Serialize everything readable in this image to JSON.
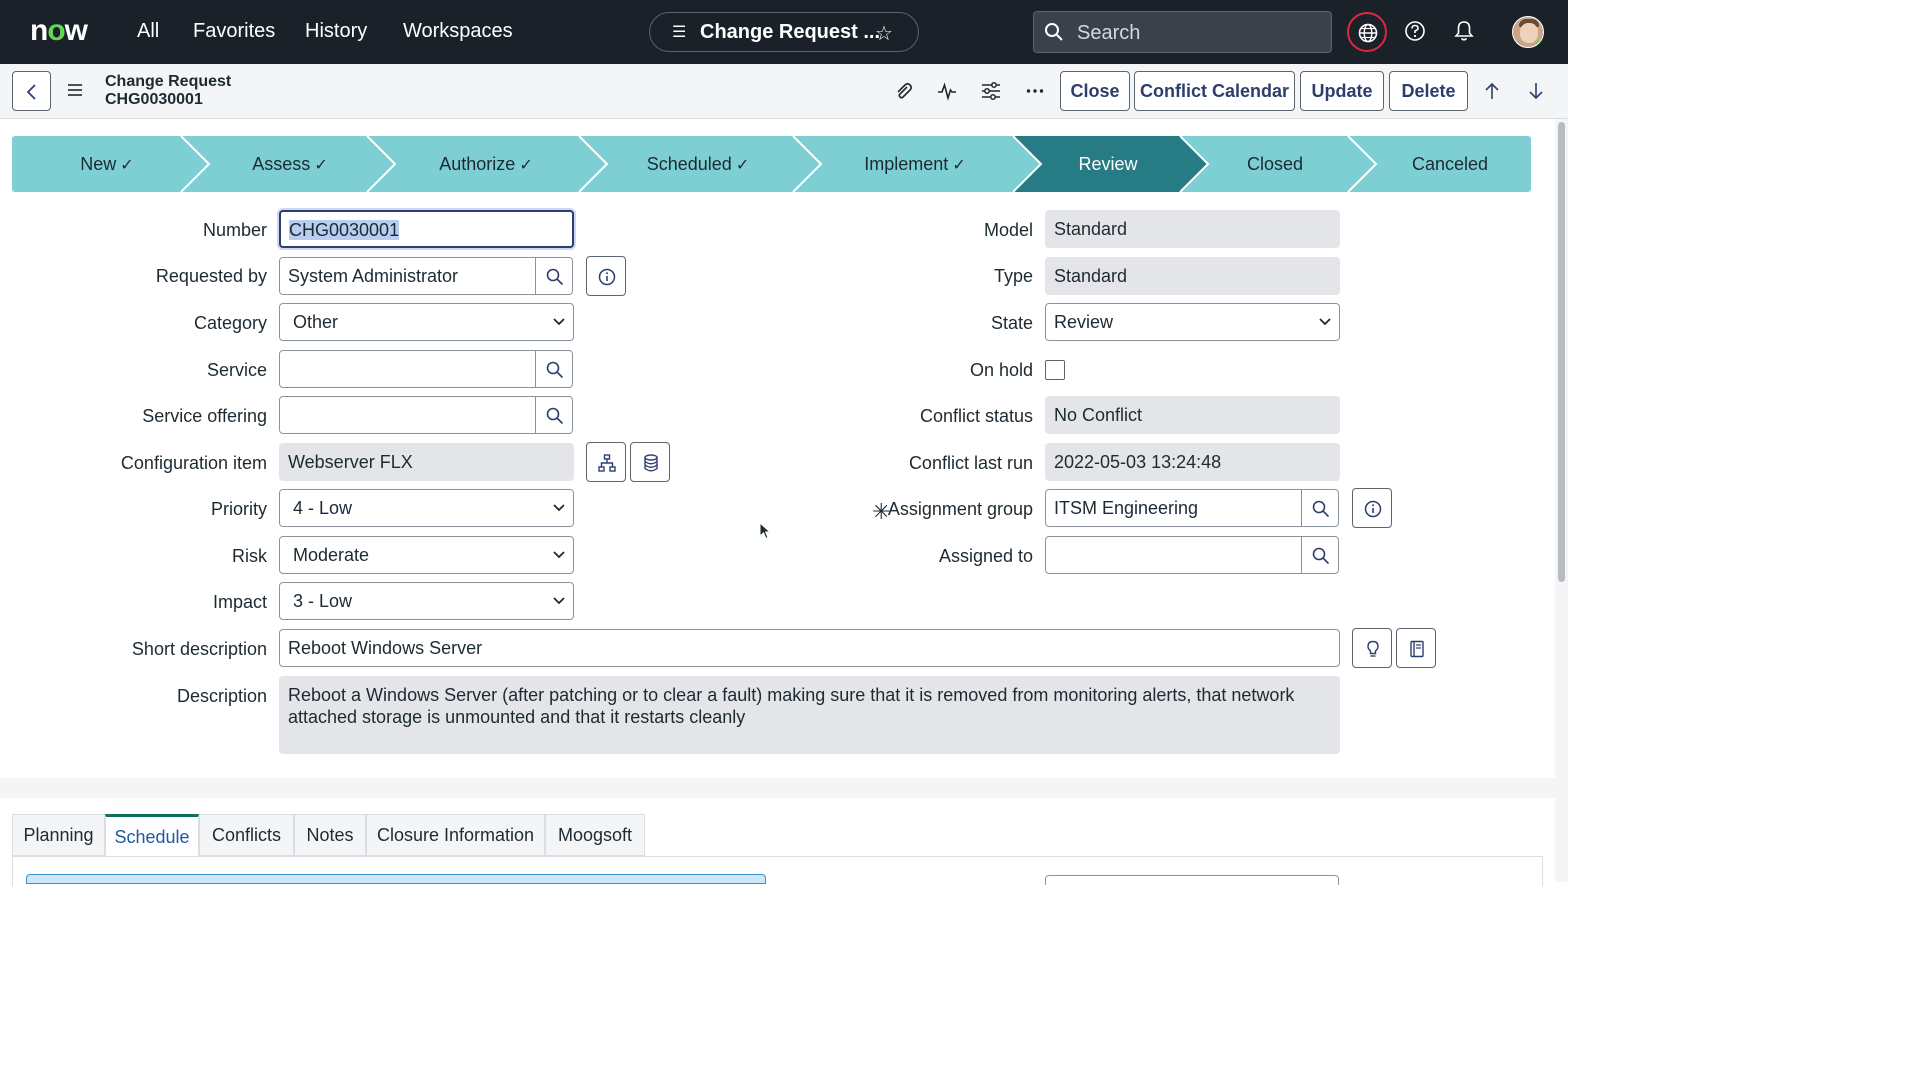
{
  "topnav": {
    "logo_pre": "n",
    "logo_o": "o",
    "logo_post": "w",
    "links": [
      "All",
      "Favorites",
      "History",
      "Workspaces"
    ],
    "record_pill_title": "Change Request ...",
    "search_placeholder": "Search"
  },
  "header": {
    "title_line1": "Change Request",
    "title_line2": "CHG0030001",
    "buttons": [
      "Close",
      "Conflict Calendar",
      "Update",
      "Delete"
    ]
  },
  "progress": {
    "stages": [
      {
        "label": "New",
        "done": "✓"
      },
      {
        "label": "Assess",
        "done": "✓"
      },
      {
        "label": "Authorize",
        "done": "✓"
      },
      {
        "label": "Scheduled",
        "done": "✓"
      },
      {
        "label": "Implement",
        "done": "✓"
      },
      {
        "label": "Review",
        "done": ""
      },
      {
        "label": "Closed",
        "done": ""
      },
      {
        "label": "Canceled",
        "done": ""
      }
    ],
    "active": "Review",
    "colors": {
      "base": "#7dcfd4",
      "active": "#277b84"
    }
  },
  "form": {
    "number": {
      "label": "Number",
      "value": "CHG0030001"
    },
    "requested_by": {
      "label": "Requested by",
      "value": "System Administrator"
    },
    "category": {
      "label": "Category",
      "value": "Other"
    },
    "service": {
      "label": "Service",
      "value": ""
    },
    "service_offering": {
      "label": "Service offering",
      "value": ""
    },
    "configuration_item": {
      "label": "Configuration item",
      "value": "Webserver FLX"
    },
    "priority": {
      "label": "Priority",
      "value": "4 - Low"
    },
    "risk": {
      "label": "Risk",
      "value": "Moderate"
    },
    "impact": {
      "label": "Impact",
      "value": "3 - Low"
    },
    "model": {
      "label": "Model",
      "value": "Standard"
    },
    "type": {
      "label": "Type",
      "value": "Standard"
    },
    "state": {
      "label": "State",
      "value": "Review"
    },
    "on_hold": {
      "label": "On hold",
      "checked": false
    },
    "conflict_status": {
      "label": "Conflict status",
      "value": "No Conflict"
    },
    "conflict_last_run": {
      "label": "Conflict last run",
      "value": "2022-05-03 13:24:48"
    },
    "assignment_group": {
      "label": "Assignment group",
      "value": "ITSM Engineering",
      "required_mark": "✳"
    },
    "assigned_to": {
      "label": "Assigned to",
      "value": ""
    },
    "short_description": {
      "label": "Short description",
      "value": "Reboot Windows Server"
    },
    "description": {
      "label": "Description",
      "value": "Reboot a Windows Server (after patching or to clear a fault) making sure that it is removed from monitoring alerts, that network attached storage is unmounted and that it restarts cleanly"
    }
  },
  "tabs": {
    "items": [
      "Planning",
      "Schedule",
      "Conflicts",
      "Notes",
      "Closure Information",
      "Moogsoft"
    ],
    "selected": "Schedule"
  }
}
